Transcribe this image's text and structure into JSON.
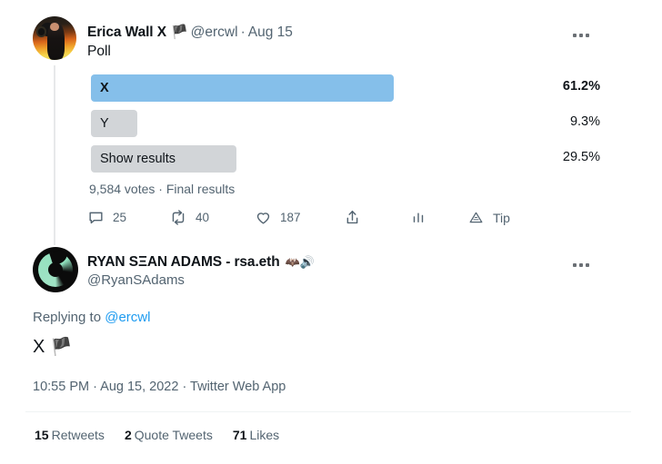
{
  "tweet_poll": {
    "author": {
      "display_name": "Erica Wall X",
      "name_badge_icon": "black-flag",
      "name_badge": "🏴",
      "handle": "@ercwl",
      "separator": "·",
      "date": "Aug 15",
      "avatar_icon": "erica-wall-avatar"
    },
    "body_text": "Poll",
    "more_menu_icon": "three-dots-icon",
    "poll": {
      "options": [
        {
          "label": "X",
          "percent": "61.2%",
          "value": 61.2,
          "winner": true
        },
        {
          "label": "Y",
          "percent": "9.3%",
          "value": 9.3,
          "winner": false
        },
        {
          "label": "Show results",
          "percent": "29.5%",
          "value": 29.5,
          "winner": false
        }
      ],
      "meta": "9,584 votes · Final results",
      "bar_color_winner": "#85bfea",
      "bar_color_other": "#d2d5d8"
    },
    "actions": {
      "reply": {
        "icon": "reply-icon",
        "count": "25"
      },
      "retweet": {
        "icon": "retweet-icon",
        "count": "40"
      },
      "like": {
        "icon": "heart-icon",
        "count": "187"
      },
      "share": {
        "icon": "share-icon",
        "count": ""
      },
      "analytics": {
        "icon": "analytics-bars-icon",
        "count": ""
      },
      "tip": {
        "icon": "tip-triangle-icon",
        "label": "Tip"
      }
    }
  },
  "tweet_reply": {
    "author": {
      "display_name": "RYAN SΞAN ADAMS - rsa.eth",
      "badges": "🦇🔊",
      "handle": "@RyanSAdams",
      "avatar_icon": "bankless-spiral-avatar"
    },
    "more_menu_icon": "three-dots-icon",
    "replying_to_prefix": "Replying to ",
    "replying_to_handle": "@ercwl",
    "body_text": "X",
    "body_flag": "🏴",
    "timestamp": "10:55 PM · Aug 15, 2022 · Twitter Web App",
    "stats": [
      {
        "count": "15",
        "label": "Retweets"
      },
      {
        "count": "2",
        "label": "Quote Tweets"
      },
      {
        "count": "71",
        "label": "Likes"
      }
    ]
  },
  "colors": {
    "link": "#1d9bf0",
    "muted": "#536471",
    "text": "#0f1419",
    "divider": "#eff3f4"
  }
}
